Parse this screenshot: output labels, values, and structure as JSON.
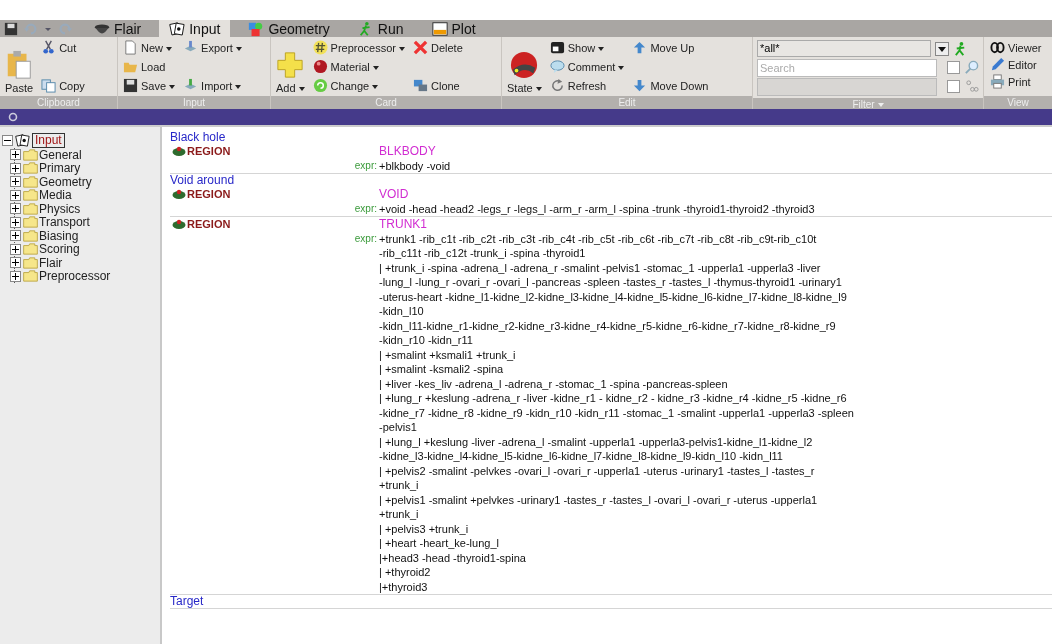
{
  "tabs": [
    {
      "label": "Flair",
      "selected": false
    },
    {
      "label": "Input",
      "selected": true
    },
    {
      "label": "Geometry",
      "selected": false
    },
    {
      "label": "Run",
      "selected": false
    },
    {
      "label": "Plot",
      "selected": false
    }
  ],
  "ribbon": {
    "groups": [
      {
        "label": "Clipboard",
        "columns": [
          [
            {
              "label": "Paste",
              "kind": "large",
              "dropdown": false
            }
          ],
          [
            {
              "label": "Cut",
              "kind": "small",
              "dropdown": false
            },
            {
              "label": "Copy",
              "kind": "small",
              "dropdown": false
            }
          ]
        ]
      },
      {
        "label": "Input",
        "columns": [
          [
            {
              "label": "New",
              "kind": "small",
              "dropdown": true
            },
            {
              "label": "Load",
              "kind": "small",
              "dropdown": false
            },
            {
              "label": "Save",
              "kind": "small",
              "dropdown": true
            }
          ],
          [
            {
              "label": "Export",
              "kind": "small",
              "dropdown": true
            },
            {
              "label": "Import",
              "kind": "small",
              "dropdown": true
            }
          ]
        ]
      },
      {
        "label": "Card",
        "columns": [
          [
            {
              "label": "Add",
              "kind": "large",
              "dropdown": true
            }
          ],
          [
            {
              "label": "Preprocessor",
              "kind": "small",
              "dropdown": true
            },
            {
              "label": "Material",
              "kind": "small",
              "dropdown": true
            },
            {
              "label": "Change",
              "kind": "small",
              "dropdown": true
            }
          ],
          [
            {
              "label": "Delete",
              "kind": "small",
              "dropdown": false
            },
            {
              "label": "Clone",
              "kind": "small",
              "dropdown": false
            }
          ]
        ]
      },
      {
        "label": "Edit",
        "columns": [
          [
            {
              "label": "State",
              "kind": "large",
              "dropdown": true
            }
          ],
          [
            {
              "label": "Show",
              "kind": "small",
              "dropdown": true
            },
            {
              "label": "Comment",
              "kind": "small",
              "dropdown": true
            },
            {
              "label": "Refresh",
              "kind": "small",
              "dropdown": false
            }
          ],
          [
            {
              "label": "Move Up",
              "kind": "small",
              "dropdown": false
            },
            {
              "label": "Move Down",
              "kind": "small",
              "dropdown": false
            }
          ]
        ]
      }
    ],
    "filter": {
      "label": "Filter",
      "dropdown": true,
      "combo": "*all*",
      "search_placeholder": "Search",
      "checks": [
        {
          "checked": false
        },
        {
          "checked": false
        }
      ]
    },
    "view": {
      "label": "View",
      "buttons": [
        "Viewer",
        "Editor",
        "Print"
      ]
    }
  },
  "tree": {
    "label": "Input",
    "expanded": true,
    "children": [
      {
        "label": "General",
        "expanded": false
      },
      {
        "label": "Primary",
        "expanded": false
      },
      {
        "label": "Geometry",
        "expanded": false
      },
      {
        "label": "Media",
        "expanded": false
      },
      {
        "label": "Physics",
        "expanded": false
      },
      {
        "label": "Transport",
        "expanded": false
      },
      {
        "label": "Biasing",
        "expanded": false
      },
      {
        "label": "Scoring",
        "expanded": false
      },
      {
        "label": "Flair",
        "expanded": false
      },
      {
        "label": "Preprocessor",
        "expanded": false
      }
    ]
  },
  "cards": [
    {
      "comment": "Black hole",
      "type": "REGION",
      "name": "BLKBODY",
      "expr_label": "expr:",
      "expr_lines": [
        "+blkbody -void"
      ]
    },
    {
      "comment": "Void around",
      "type": "REGION",
      "name": "VOID",
      "expr_label": "expr:",
      "expr_lines": [
        "+void -head -head2 -legs_r -legs_l -arm_r -arm_l -spina -trunk -thyroid1-thyroid2 -thyroid3"
      ]
    },
    {
      "type": "REGION",
      "name": "TRUNK1",
      "expr_label": "expr:",
      "expr_lines": [
        "+trunk1 -rib_c1t -rib_c2t -rib_c3t -rib_c4t -rib_c5t -rib_c6t -rib_c7t -rib_c8t -rib_c9t-rib_c10t",
        "-rib_c11t -rib_c12t -trunk_i -spina -thyroid1",
        "| +trunk_i -spina -adrena_l -adrena_r -smalint -pelvis1 -stomac_1 -upperla1 -upperla3 -liver",
        "-lung_l -lung_r -ovari_r -ovari_l -pancreas -spleen -tastes_r -tastes_l -thymus-thyroid1 -urinary1",
        "-uterus-heart -kidne_l1-kidne_l2-kidne_l3-kidne_l4-kidne_l5-kidne_l6-kidne_l7-kidne_l8-kidne_l9",
        "-kidn_l10",
        "-kidn_l11-kidne_r1-kidne_r2-kidne_r3-kidne_r4-kidne_r5-kidne_r6-kidne_r7-kidne_r8-kidne_r9",
        "-kidn_r10 -kidn_r11",
        "| +smalint +ksmali1 +trunk_i",
        "| +smalint -ksmali2 -spina",
        "| +liver -kes_liv -adrena_l -adrena_r -stomac_1 -spina -pancreas-spleen",
        "| +lung_r +keslung -adrena_r -liver -kidne_r1 - kidne_r2 - kidne_r3 -kidne_r4 -kidne_r5 -kidne_r6",
        "-kidne_r7 -kidne_r8 -kidne_r9 -kidn_r10 -kidn_r11 -stomac_1 -smalint -upperla1 -upperla3 -spleen",
        "-pelvis1",
        "| +lung_l +keslung -liver -adrena_l -smalint -upperla1 -upperla3-pelvis1-kidne_l1-kidne_l2",
        "-kidne_l3-kidne_l4-kidne_l5-kidne_l6-kidne_l7-kidne_l8-kidne_l9-kidn_l10 -kidn_l11",
        "| +pelvis2 -smalint -pelvkes -ovari_l -ovari_r -upperla1 -uterus -urinary1 -tastes_l -tastes_r",
        "+trunk_i",
        "| +pelvis1 -smalint +pelvkes -urinary1 -tastes_r -tastes_l -ovari_l -ovari_r -uterus -upperla1",
        "+trunk_i",
        "| +pelvis3 +trunk_i",
        "| +heart -heart_ke-lung_l",
        "|+head3 -head -thyroid1-spina",
        "| +thyroid2",
        "|+thyroid3"
      ]
    },
    {
      "comment": "Target"
    }
  ]
}
